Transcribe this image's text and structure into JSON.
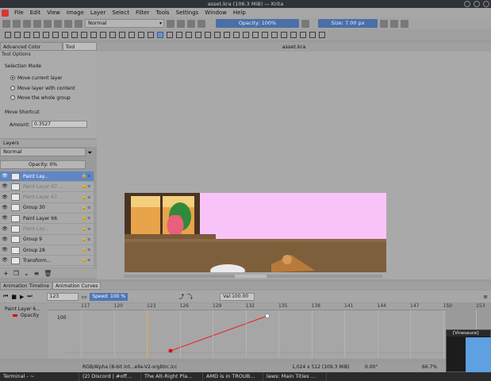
{
  "window": {
    "title": "asset.kra (106.3 MiB) — Krita"
  },
  "menu": [
    "File",
    "Edit",
    "View",
    "Image",
    "Layer",
    "Select",
    "Filter",
    "Tools",
    "Settings",
    "Window",
    "Help"
  ],
  "toolbar": {
    "blend_mode": "Normal",
    "opacity": "Opacity: 100%",
    "size": "Size: 7.00 px"
  },
  "docker_tabs": [
    "Advanced Color Selector",
    "Tool Options"
  ],
  "tool_options": {
    "title": "Tool Options",
    "selection_mode": "Selection Mode",
    "options": [
      "Move current layer",
      "Move layer with content",
      "Move the whole group"
    ],
    "move_shortcut": "Move Shortcut",
    "amount_label": "Amount:",
    "amount_value": "0.3527"
  },
  "layers": {
    "header": "Layers",
    "blend": "Normal",
    "opacity": "Opacity:  0%",
    "items": [
      {
        "name": "Paint Lay...",
        "selected": true,
        "dim": false
      },
      {
        "name": "Paint Layer 67 ...",
        "selected": false,
        "dim": true
      },
      {
        "name": "Paint Layer 67 ...",
        "selected": false,
        "dim": true
      },
      {
        "name": "Group 30",
        "selected": false,
        "dim": false
      },
      {
        "name": "Paint Layer 66",
        "selected": false,
        "dim": false
      },
      {
        "name": "Paint Lay...",
        "selected": false,
        "dim": true
      },
      {
        "name": "Group 9",
        "selected": false,
        "dim": false
      },
      {
        "name": "Group 28",
        "selected": false,
        "dim": false
      },
      {
        "name": "Transform...",
        "selected": false,
        "dim": false
      }
    ]
  },
  "canvas": {
    "tab": "asset.kra"
  },
  "animation": {
    "tabs": [
      "Animation Timeline",
      "Animation Curves"
    ],
    "frame": "123",
    "speed": "Speed: 100 %",
    "val": "Val:100.00",
    "ticks": [
      "117",
      "120",
      "123",
      "126",
      "129",
      "132",
      "135",
      "138",
      "141",
      "144",
      "147",
      "150",
      "153"
    ],
    "y_label": "100",
    "tree": {
      "layer": "Paint Layer 6...",
      "channel": "Opacity"
    }
  },
  "status": {
    "color": "RGB/Alpha (8-bit int...elle-V2-srgbtrc.icc",
    "dims": "1,024 x 512 (109.3 MiB)",
    "rotation": "0.00°",
    "zoom": "66.7%"
  },
  "taskbar": [
    "Terminal - ~",
    "(2) Discord | #off...",
    "The Alt-Right Pla...",
    "AMD is in TROUB...",
    "laws: Main Titles ..."
  ],
  "popup": {
    "title": "[Vinesauce]"
  }
}
